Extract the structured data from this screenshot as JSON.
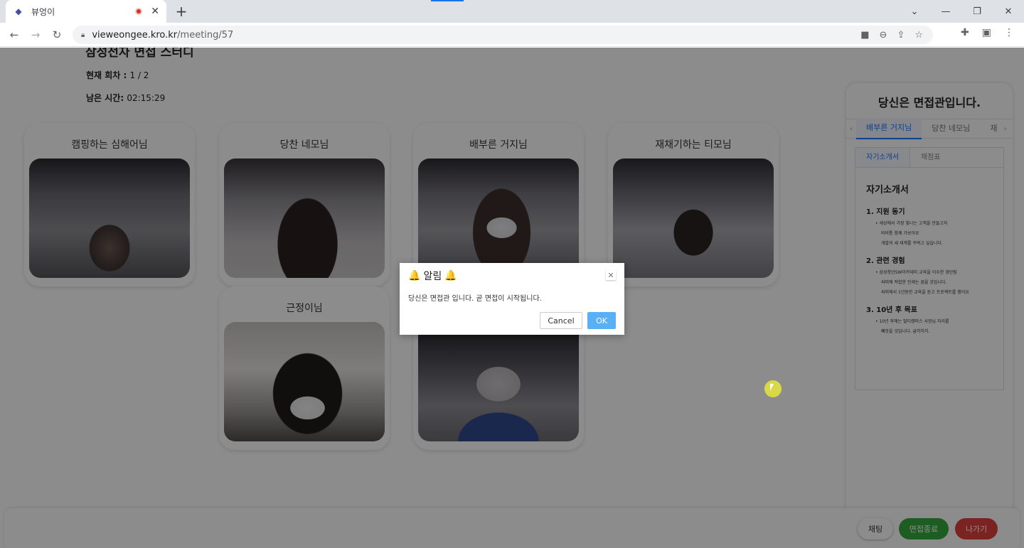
{
  "browser": {
    "tab_title": "뷰엉이",
    "tab_close": "✕",
    "newtab": "+",
    "url_domain": "vieweongee.kro.kr",
    "url_path": "/meeting/57",
    "window_controls": [
      "⌄",
      "—",
      "❐",
      "✕"
    ]
  },
  "meeting": {
    "title": "삼성전자 면접 스터디",
    "round_label": "현재 회차 : ",
    "round_value": "1 / 2",
    "remaining_label": "남은 시간: ",
    "remaining_value": "02:15:29"
  },
  "participants": [
    {
      "name": "캠핑하는 심해어님"
    },
    {
      "name": "당찬 네모님"
    },
    {
      "name": "배부른 거지님"
    },
    {
      "name": "재채기하는 티모님"
    },
    {
      "name": "근정이님"
    },
    {
      "name": ""
    }
  ],
  "panel": {
    "title": "당신은 면접관입니다.",
    "tabs": [
      "배부른 거지님",
      "당찬 네모님",
      "재"
    ],
    "doc_tabs": [
      "자기소개서",
      "채점표"
    ],
    "doc_heading": "자기소개서",
    "sections": [
      {
        "title": "1. 지원 동기",
        "lines": [
          "세상에서 가장 빛나는 고객을 만들고자",
          "비비통 함께 가보아요",
          "개발의 새 세계를 꾸며고 싶습니다."
        ]
      },
      {
        "title": "2. 관련 경험",
        "lines": [
          "삼성청년SW아카데미 교육을 이수한 경단팀",
          "싸피에 적합한 인재는 꿈을 것입니다.",
          "싸피에서 1년동안 교육을 듣고 프로젝트를 했어요"
        ]
      },
      {
        "title": "3. 10년 후 목표",
        "lines": [
          "10년 후에는 멀티캠퍼스 사장님 자리를",
          "빼앗을 것입니다. 굽히히히."
        ]
      }
    ]
  },
  "bottom": {
    "chat": "채팅",
    "end": "면접종료",
    "exit": "나가기"
  },
  "dialog": {
    "title": "알림",
    "bell": "🔔",
    "message": "당신은 면접관 입니다. 곧 면접이 시작됩니다.",
    "cancel": "Cancel",
    "ok": "OK",
    "close": "✕"
  },
  "colors": {
    "accent": "#1677ff",
    "end_button": "#38a93c",
    "exit_button": "#e0413b",
    "ok_button": "#5ab0f5"
  }
}
